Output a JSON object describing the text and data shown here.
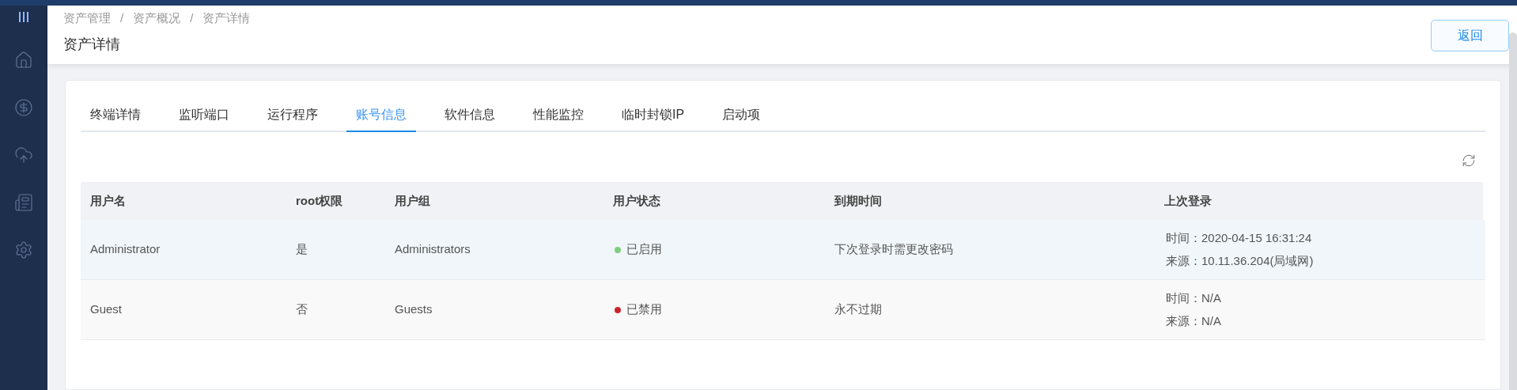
{
  "breadcrumb": [
    "资产管理",
    "资产概况",
    "资产详情"
  ],
  "breadcrumb_separators": [
    "/",
    "/"
  ],
  "page_title": "资产详情",
  "back_button": "返回",
  "sidebar": {
    "items": [
      {
        "kind": "home"
      },
      {
        "kind": "finance"
      },
      {
        "kind": "upload"
      },
      {
        "kind": "report"
      },
      {
        "kind": "settings"
      }
    ]
  },
  "tabs": [
    {
      "label": "终端详情",
      "selected": false
    },
    {
      "label": "监听端口",
      "selected": false
    },
    {
      "label": "运行程序",
      "selected": false
    },
    {
      "label": "账号信息",
      "selected": true
    },
    {
      "label": "软件信息",
      "selected": false
    },
    {
      "label": "性能监控",
      "selected": false
    },
    {
      "label": "临时封锁IP",
      "selected": false
    },
    {
      "label": "启动项",
      "selected": false
    }
  ],
  "table": {
    "columns": [
      "用户名",
      "root权限",
      "用户组",
      "用户状态",
      "到期时间",
      "上次登录"
    ],
    "rows": [
      {
        "username": "Administrator",
        "root": "是",
        "group": "Administrators",
        "status": "已启用",
        "color": "#7dcf7f",
        "expiry": "下次登录时需更改密码",
        "last_login": [
          "时间：2020-04-15 16:31:24",
          "来源：10.11.36.204(局域网)"
        ]
      },
      {
        "username": "Guest",
        "root": "否",
        "group": "Guests",
        "status": "已禁用",
        "color": "#c9272d",
        "expiry": "永不过期",
        "last_login": [
          "时间：N/A",
          "来源：N/A"
        ]
      }
    ]
  }
}
